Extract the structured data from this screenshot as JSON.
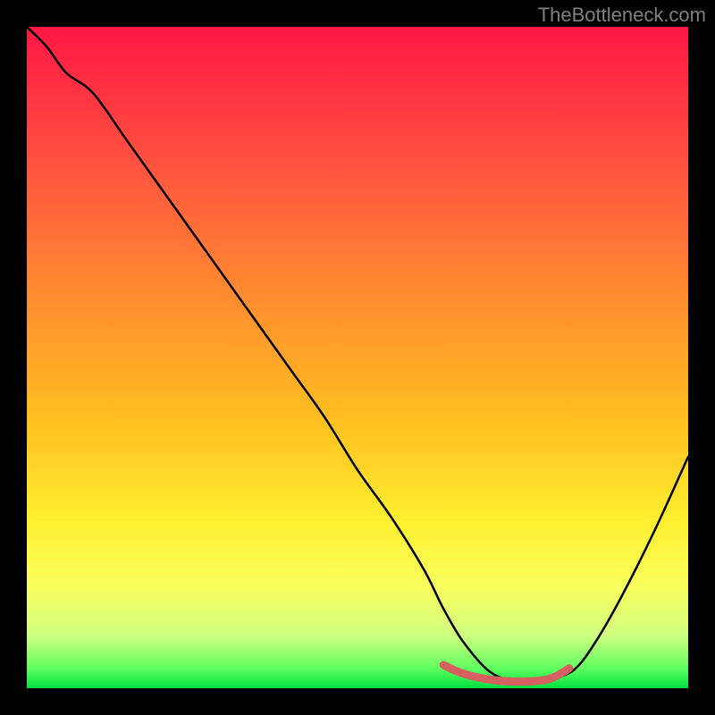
{
  "watermark": "TheBottleneck.com",
  "chart_data": {
    "type": "line",
    "title": "",
    "xlabel": "",
    "ylabel": "",
    "xlim": [
      0,
      100
    ],
    "ylim": [
      0,
      100
    ],
    "series": [
      {
        "name": "bottleneck-curve",
        "x": [
          0,
          3,
          6,
          10,
          15,
          20,
          25,
          30,
          35,
          40,
          45,
          50,
          55,
          60,
          63,
          66,
          70,
          74,
          78,
          80,
          83,
          86,
          90,
          95,
          100
        ],
        "y": [
          100,
          97,
          93,
          90,
          83,
          76,
          69,
          62,
          55,
          48,
          41,
          33,
          26,
          18,
          12,
          7,
          2.5,
          1,
          1,
          1.5,
          3,
          7,
          14,
          24,
          35
        ]
      },
      {
        "name": "optimal-zone-highlight",
        "x": [
          63,
          66,
          70,
          74,
          78,
          80,
          82
        ],
        "y": [
          3.5,
          2.2,
          1.3,
          1,
          1.2,
          1.8,
          3
        ]
      }
    ],
    "gradient_stops": [
      {
        "offset": 0,
        "color": "#ff1744"
      },
      {
        "offset": 20,
        "color": "#ff5040"
      },
      {
        "offset": 40,
        "color": "#ff8a30"
      },
      {
        "offset": 60,
        "color": "#ffc020"
      },
      {
        "offset": 75,
        "color": "#fff030"
      },
      {
        "offset": 85,
        "color": "#f8ff60"
      },
      {
        "offset": 92,
        "color": "#d0ff80"
      },
      {
        "offset": 97,
        "color": "#60ff60"
      },
      {
        "offset": 100,
        "color": "#00e040"
      }
    ],
    "highlight_color": "#d66060"
  }
}
